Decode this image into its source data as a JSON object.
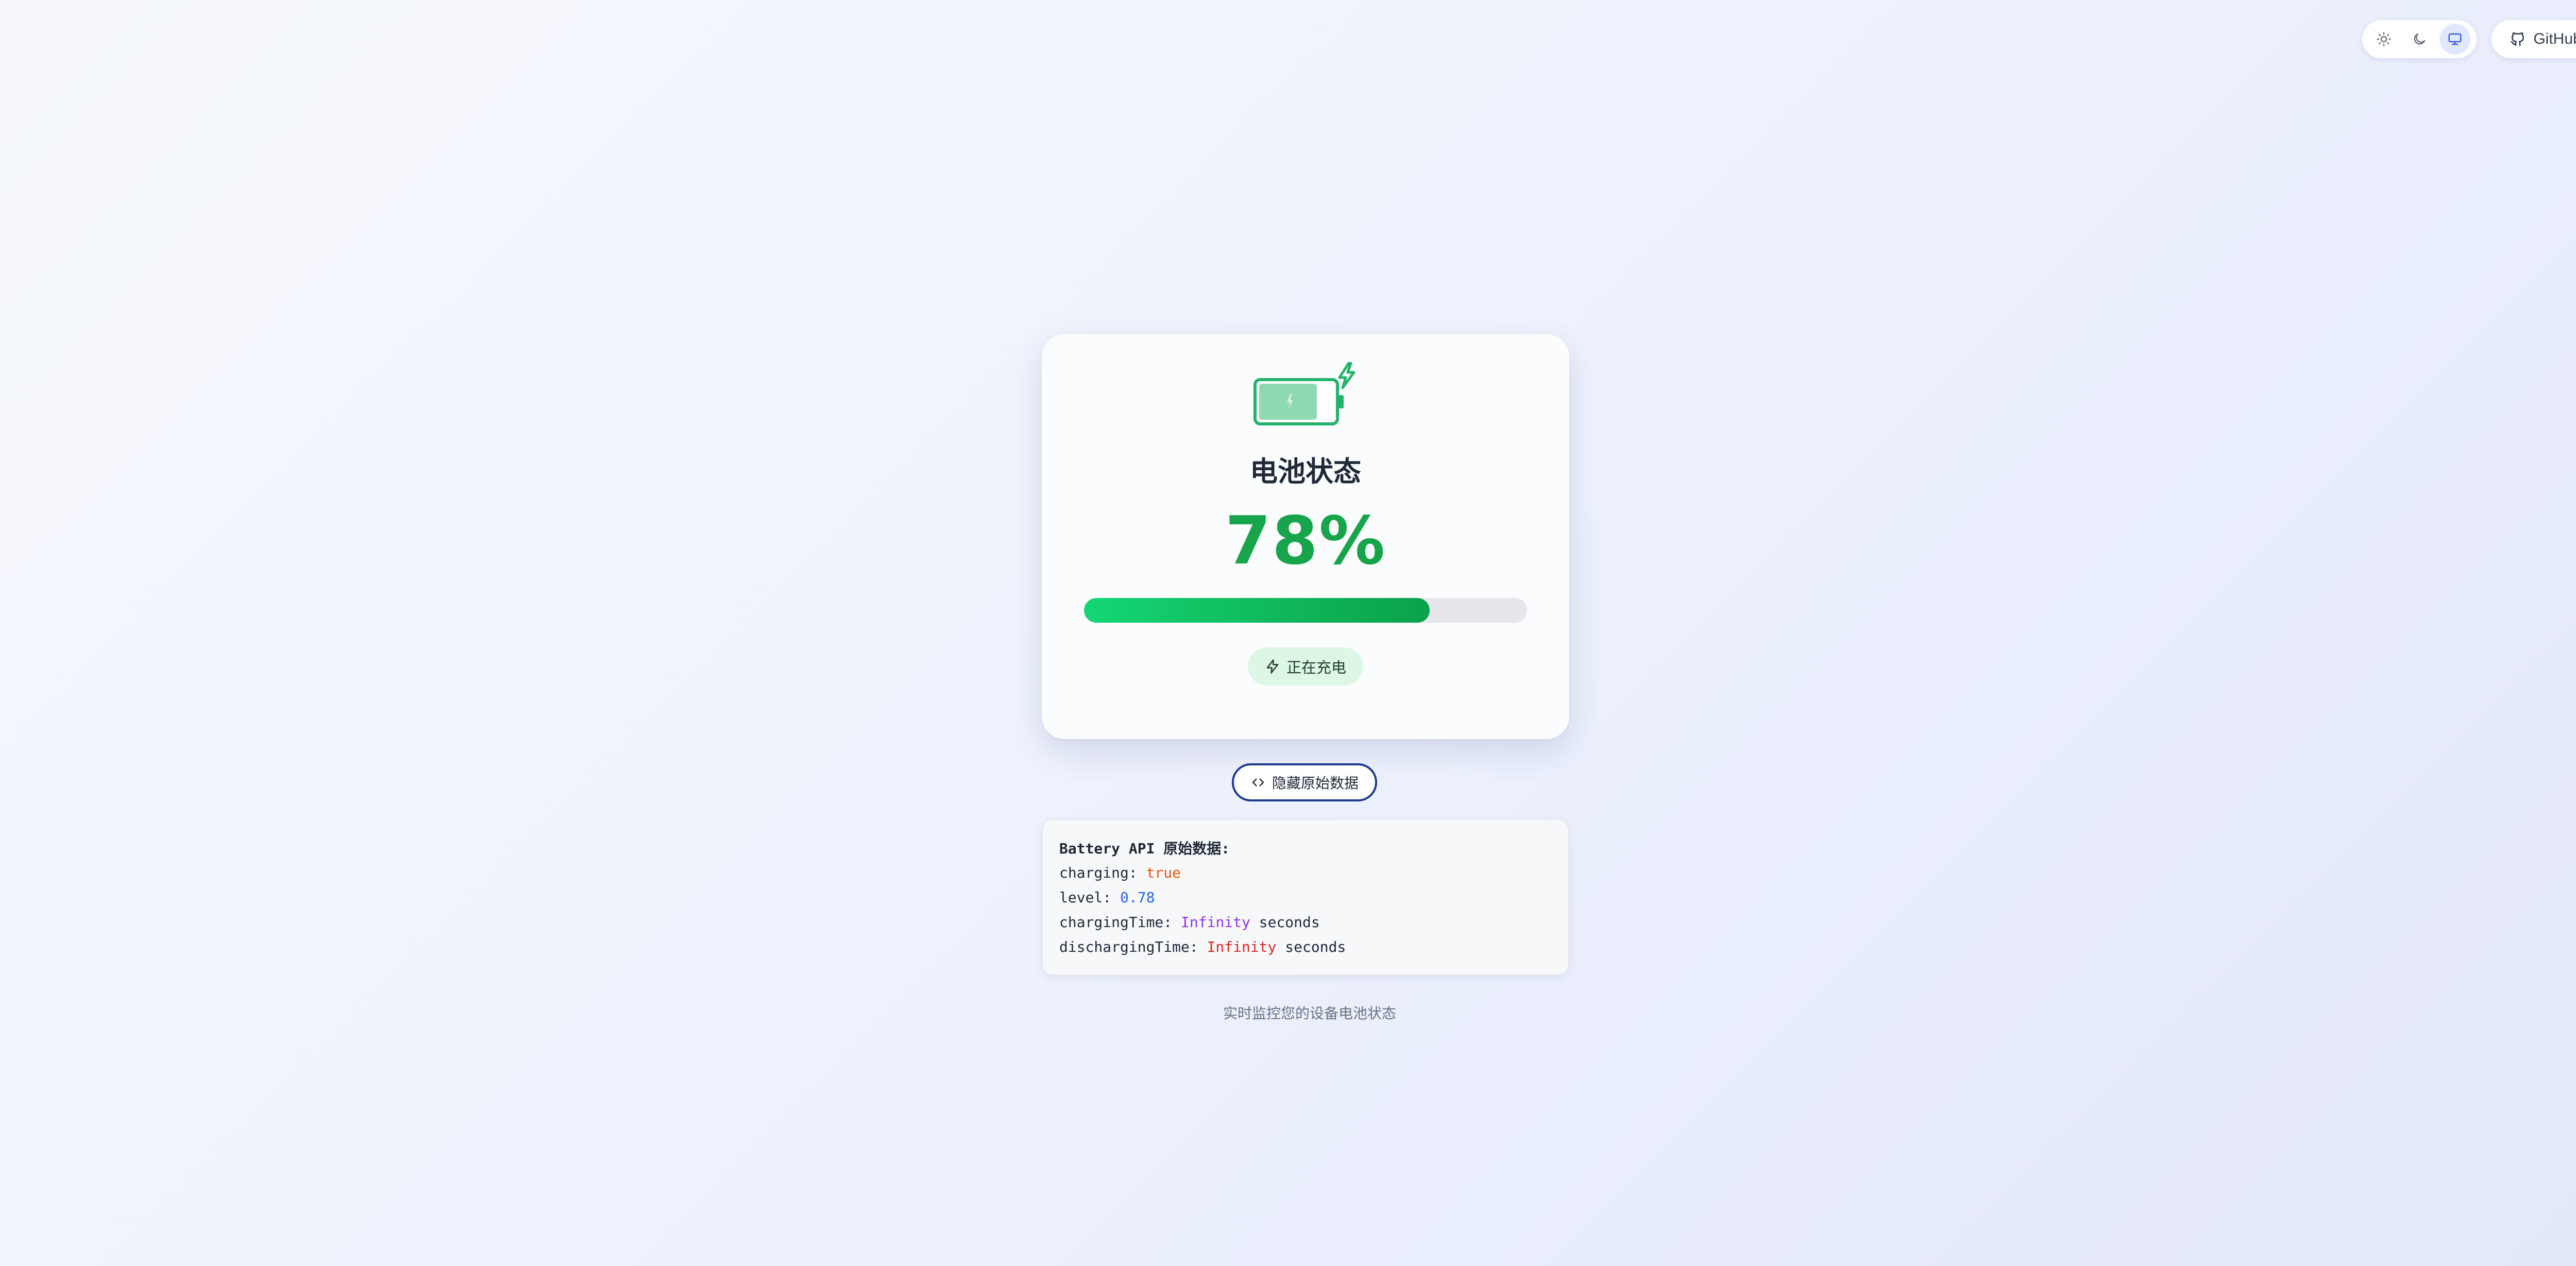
{
  "theme_switcher": {
    "options": [
      {
        "icon": "sun-icon",
        "label": "light"
      },
      {
        "icon": "moon-icon",
        "label": "dark"
      },
      {
        "icon": "monitor-icon",
        "label": "system"
      }
    ],
    "active": "system"
  },
  "github_button": {
    "label": "GitHub",
    "icon": "github-icon"
  },
  "battery_card": {
    "title": "电池状态",
    "percent_text": "78%",
    "level_fraction": 0.78,
    "charging_label": "正在充电",
    "icon": "battery-charging-icon"
  },
  "raw_toggle": {
    "label": "隐藏原始数据",
    "icon": "code-icon"
  },
  "raw_data": {
    "heading": "Battery API 原始数据:",
    "charging_key": "charging: ",
    "charging_value": "true",
    "level_key": "level: ",
    "level_value": "0.78",
    "charging_time_key": "chargingTime: ",
    "charging_time_value": "Infinity",
    "charging_time_unit": " seconds",
    "discharging_time_key": "dischargingTime: ",
    "discharging_time_value": "Infinity",
    "discharging_time_unit": " seconds"
  },
  "footer": {
    "text": "实时监控您的设备电池状态"
  },
  "colors": {
    "accent_green": "#17a44a",
    "progress_start": "#14d675",
    "progress_end": "#0aa24a",
    "toggle_border": "#1e3a8a"
  }
}
